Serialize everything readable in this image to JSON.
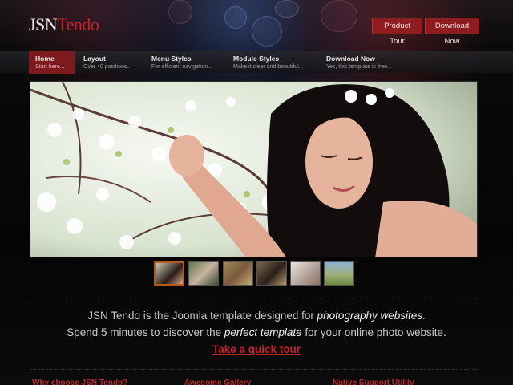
{
  "header": {
    "logo_part1": "JSN",
    "logo_part2": "Tendo",
    "product_tour_label": "Product Tour",
    "download_now_label": "Download Now"
  },
  "nav": {
    "items": [
      {
        "title": "Home",
        "subtitle": "Start here..."
      },
      {
        "title": "Layout",
        "subtitle": "Over 40 positions..."
      },
      {
        "title": "Menu Styles",
        "subtitle": "For efficient navigation..."
      },
      {
        "title": "Module Styles",
        "subtitle": "Make it clear and beautiful..."
      },
      {
        "title": "Download Now",
        "subtitle": "Yes, this template is free..."
      }
    ]
  },
  "intro": {
    "line1_pre": "JSN Tendo is the Joomla template designed for ",
    "line1_em": "photography websites",
    "line1_post": ".",
    "line2_pre": "Spend 5 minutes to discover the ",
    "line2_em": "perfect template",
    "line2_post": " for your online photo website.",
    "link_label": "Take a quick tour"
  },
  "bottom_headings": [
    "Why choose JSN Tendo?",
    "Awesome Gallery",
    "Native Support Utility"
  ],
  "colors": {
    "accent": "#8e1c20",
    "accent_bright": "#c4232c"
  }
}
